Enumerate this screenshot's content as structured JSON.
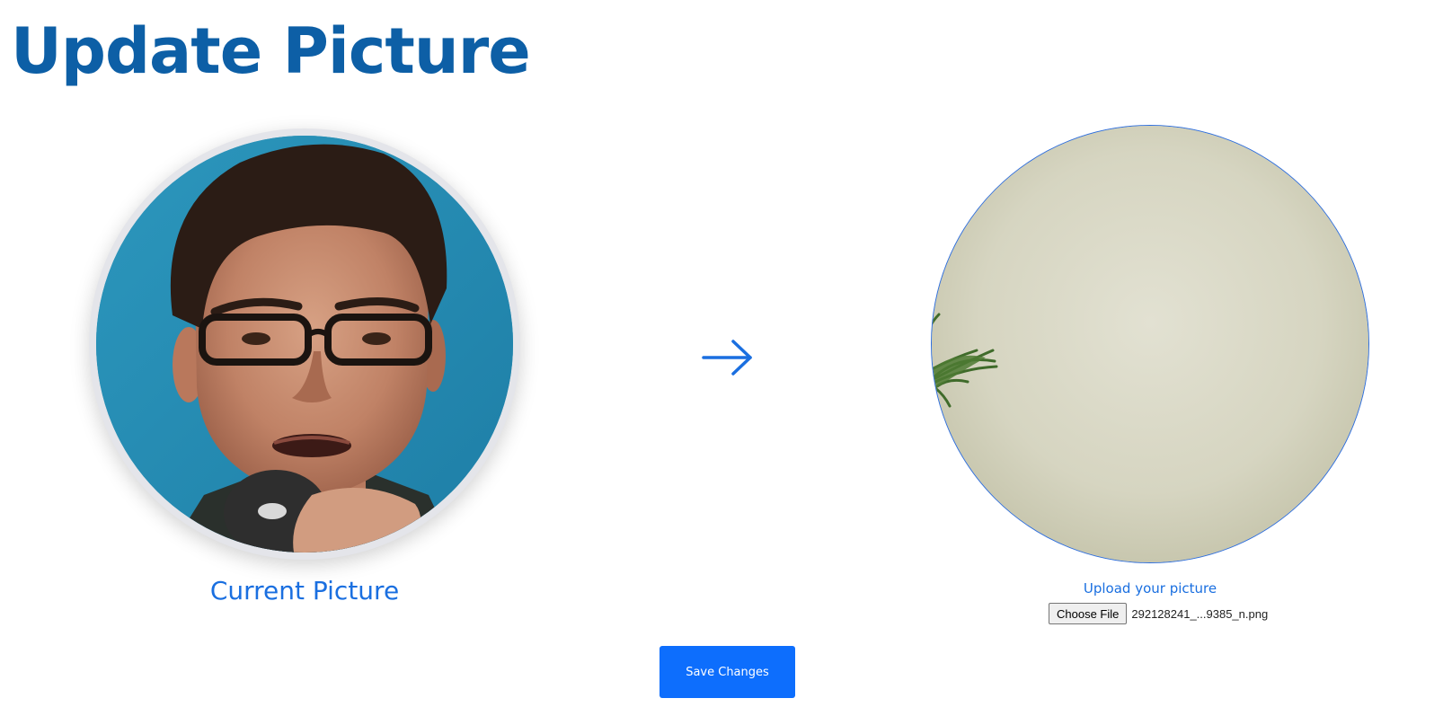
{
  "page": {
    "title": "Update Picture"
  },
  "current": {
    "caption": "Current Picture",
    "image_icon": "profile-photo"
  },
  "transition": {
    "icon": "arrow-right-icon"
  },
  "upload": {
    "label": "Upload your picture",
    "choose_button_label": "Choose File",
    "selected_file_name": "292128241_...9385_n.png"
  },
  "actions": {
    "save_label": "Save Changes"
  },
  "colors": {
    "title": "#0d5fa6",
    "accent": "#1a6fe0",
    "button": "#0d6efd"
  }
}
